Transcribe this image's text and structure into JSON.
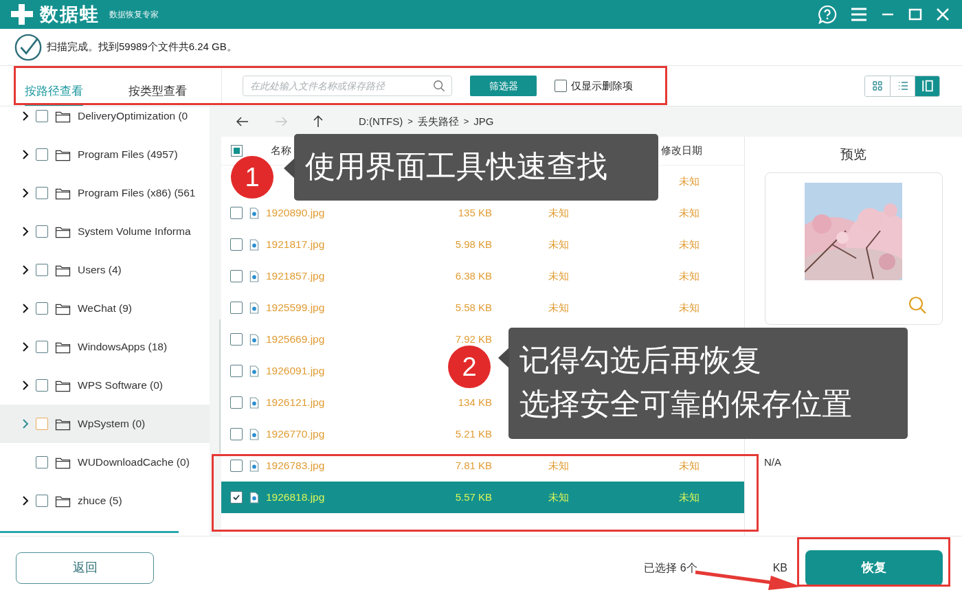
{
  "window": {
    "app_name": "数据蛙",
    "subtitle": "数据恢复专家"
  },
  "scan_status": "扫描完成。找到59989个文件共6.24 GB。",
  "view_tabs": [
    {
      "label": "按路径查看",
      "selected": true
    },
    {
      "label": "按类型查看",
      "selected": false
    }
  ],
  "search": {
    "placeholder": "在此处输入文件名称或保存路径"
  },
  "filter_button": "筛选器",
  "deleted_only": {
    "label": "仅显示删除项",
    "checked": false
  },
  "view_modes": [
    {
      "kind": "grid",
      "selected": false
    },
    {
      "kind": "list",
      "selected": false
    },
    {
      "kind": "columns",
      "selected": true
    }
  ],
  "folder_tree": [
    {
      "label": "DeliveryOptimization (0",
      "expandable": true,
      "checked": false,
      "selected": false
    },
    {
      "label": "Program Files (4957)",
      "expandable": true,
      "checked": false,
      "selected": false
    },
    {
      "label": "Program Files (x86) (561",
      "expandable": true,
      "checked": false,
      "selected": false
    },
    {
      "label": "System Volume Informa",
      "expandable": true,
      "checked": false,
      "selected": false
    },
    {
      "label": "Users (4)",
      "expandable": true,
      "checked": false,
      "selected": false
    },
    {
      "label": "WeChat (9)",
      "expandable": true,
      "checked": false,
      "selected": false
    },
    {
      "label": "WindowsApps (18)",
      "expandable": true,
      "checked": false,
      "selected": false
    },
    {
      "label": "WPS Software (0)",
      "expandable": true,
      "checked": false,
      "selected": false
    },
    {
      "label": "WpSystem (0)",
      "expandable": true,
      "checked": false,
      "selected": true
    },
    {
      "label": "WUDownloadCache (0)",
      "expandable": false,
      "checked": false,
      "selected": false
    },
    {
      "label": "zhuce (5)",
      "expandable": true,
      "checked": false,
      "selected": false
    }
  ],
  "nav_buttons": [
    {
      "kind": "back",
      "disabled": false
    },
    {
      "kind": "forward",
      "disabled": true
    },
    {
      "kind": "up",
      "disabled": false
    }
  ],
  "breadcrumb": [
    {
      "kind": "crumb",
      "text": "D:(NTFS)"
    },
    {
      "kind": "separator",
      "text": ">"
    },
    {
      "kind": "crumb",
      "text": "丢失路径"
    },
    {
      "kind": "separator",
      "text": ">"
    },
    {
      "kind": "crumb",
      "text": "JPG"
    }
  ],
  "table": {
    "select_all_partial": true,
    "columns": [
      {
        "kind": "name",
        "label": "名称"
      },
      {
        "kind": "modified",
        "label": "修改日期"
      }
    ],
    "rows": [
      {
        "modified": "未知",
        "selected": false
      },
      {
        "name": "1920890.jpg",
        "size": "135 KB",
        "created": "未知",
        "modified": "未知",
        "checked": false,
        "selected": false
      },
      {
        "name": "1921817.jpg",
        "size": "5.98 KB",
        "created": "未知",
        "modified": "未知",
        "checked": false,
        "selected": false
      },
      {
        "name": "1921857.jpg",
        "size": "6.38 KB",
        "created": "未知",
        "modified": "未知",
        "checked": false,
        "selected": false
      },
      {
        "name": "1925599.jpg",
        "size": "5.58 KB",
        "created": "未知",
        "modified": "未知",
        "checked": false,
        "selected": false
      },
      {
        "name": "1925669.jpg",
        "size": "7.92 KB",
        "checked": false,
        "selected": false
      },
      {
        "name": "1926091.jpg",
        "checked": false,
        "selected": false
      },
      {
        "name": "1926121.jpg",
        "size": "134 KB",
        "checked": false,
        "selected": false
      },
      {
        "name": "1926770.jpg",
        "size": "5.21 KB",
        "checked": false,
        "selected": false
      },
      {
        "name": "1926783.jpg",
        "size": "7.81 KB",
        "created": "未知",
        "modified": "未知",
        "checked": false,
        "selected": false
      },
      {
        "name": "1926818.jpg",
        "size": "5.57 KB",
        "created": "未知",
        "modified": "未知",
        "checked": true,
        "selected": true
      }
    ]
  },
  "preview": {
    "title": "预览",
    "path_value": "N/A"
  },
  "footer": {
    "back_button": "返回",
    "selection_summary": "已选择 6个",
    "selection_unit": "KB",
    "recover_button": "恢复"
  },
  "callouts": [
    {
      "number": "1",
      "lines": [
        "使用界面工具快速查找"
      ]
    },
    {
      "number": "2",
      "lines": [
        "记得勾选后再恢复",
        "选择安全可靠的保存位置"
      ]
    }
  ]
}
